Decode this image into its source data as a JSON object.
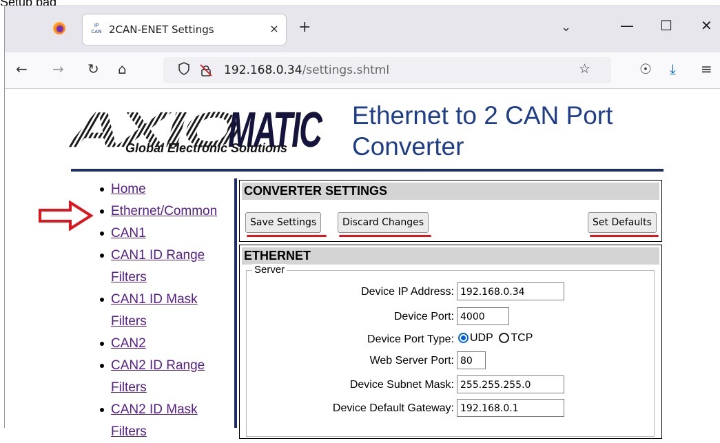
{
  "caption_fragment": "Setup pag",
  "browser": {
    "tab_title": "2CAN-ENET Settings",
    "favicon_text_top": "IP",
    "favicon_text_bottom": "CAN",
    "close_tab": "×",
    "new_tab": "+",
    "tab_list": "⌄",
    "minimize": "—",
    "maximize": "☐",
    "close_window": "✕",
    "back": "←",
    "forward": "→",
    "reload": "↻",
    "home": "⌂",
    "url_host": "192.168.0.34",
    "url_path": "/settings.shtml",
    "bookmark": "☆",
    "pocket": "☉",
    "download": "⤓",
    "menu": "≡"
  },
  "page": {
    "logo_text": "AXIOMATIC",
    "logo_subtitle": "Global Electronic Solutions",
    "title": "Ethernet to 2 CAN Port Converter",
    "nav": [
      {
        "label": "Home"
      },
      {
        "label": "Ethernet/Common"
      },
      {
        "label": "CAN1"
      },
      {
        "label": "CAN1 ID Range Filters"
      },
      {
        "label": "CAN1 ID Mask Filters"
      },
      {
        "label": "CAN2"
      },
      {
        "label": "CAN2 ID Range Filters"
      },
      {
        "label": "CAN2 ID Mask Filters"
      }
    ],
    "converter": {
      "heading": "CONVERTER SETTINGS",
      "save_label": "Save Settings",
      "discard_label": "Discard Changes",
      "defaults_label": "Set Defaults"
    },
    "ethernet": {
      "heading": "ETHERNET",
      "legend": "Server",
      "ip_label": "Device IP Address:",
      "ip_value": "192.168.0.34",
      "port_label": "Device Port:",
      "port_value": "4000",
      "port_type_label": "Device Port Type:",
      "port_type_options": [
        "UDP",
        "TCP"
      ],
      "port_type_selected": "UDP",
      "web_port_label": "Web Server Port:",
      "web_port_value": "80",
      "subnet_label": "Device Subnet Mask:",
      "subnet_value": "255.255.255.0",
      "gateway_label": "Device Default Gateway:",
      "gateway_value": "192.168.0.1"
    }
  },
  "colors": {
    "title_blue": "#1e3d8a",
    "rule_navy": "#1b2e6b",
    "link_purple": "#55208a",
    "annotation_red": "#e0141c",
    "radio_blue": "#0060df"
  }
}
